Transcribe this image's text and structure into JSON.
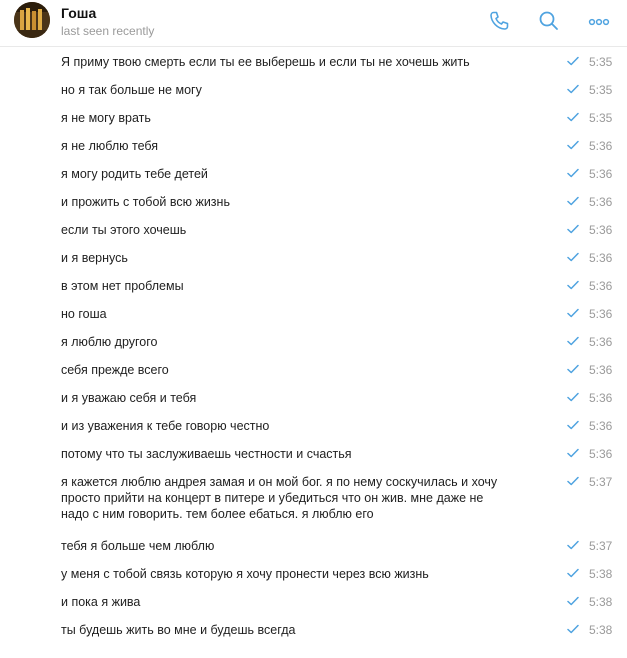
{
  "header": {
    "title": "Гоша",
    "status": "last seen recently",
    "icons": [
      "phone-icon",
      "search-icon",
      "more-icon"
    ],
    "accent_color": "#4fa3e0"
  },
  "messages": [
    {
      "text": "Я приму твою смерть если ты ее выберешь и если ты не хочешь жить",
      "time": "5:35",
      "status": "read"
    },
    {
      "text": "но я так больше не могу",
      "time": "5:35",
      "status": "read"
    },
    {
      "text": "я не могу врать",
      "time": "5:35",
      "status": "read"
    },
    {
      "text": "я не люблю тебя",
      "time": "5:36",
      "status": "read"
    },
    {
      "text": "я могу родить тебе детей",
      "time": "5:36",
      "status": "read"
    },
    {
      "text": "и прожить с тобой всю жизнь",
      "time": "5:36",
      "status": "read"
    },
    {
      "text": "если ты этого хочешь",
      "time": "5:36",
      "status": "read"
    },
    {
      "text": "и я вернусь",
      "time": "5:36",
      "status": "read"
    },
    {
      "text": "в этом нет проблемы",
      "time": "5:36",
      "status": "read"
    },
    {
      "text": "но гоша",
      "time": "5:36",
      "status": "read"
    },
    {
      "text": "я люблю другого",
      "time": "5:36",
      "status": "read"
    },
    {
      "text": "себя прежде всего",
      "time": "5:36",
      "status": "read"
    },
    {
      "text": "и я уважаю себя и тебя",
      "time": "5:36",
      "status": "read"
    },
    {
      "text": "и из уважения к тебе говорю честно",
      "time": "5:36",
      "status": "read"
    },
    {
      "text": "потому что ты заслуживаешь честности и счастья",
      "time": "5:36",
      "status": "read"
    },
    {
      "text": "я кажется люблю андрея замая и он мой бог. я по нему соскучилась и хочу просто прийти на концерт в питере и убедиться что он жив. мне даже не надо с ним говорить. тем более ебаться. я люблю его",
      "time": "5:37",
      "status": "read"
    },
    {
      "text": "тебя я больше чем люблю",
      "time": "5:37",
      "status": "read"
    },
    {
      "text": "у меня с тобой связь которую я хочу пронести через всю жизнь",
      "time": "5:38",
      "status": "read"
    },
    {
      "text": "и пока я жива",
      "time": "5:38",
      "status": "read"
    },
    {
      "text": "ты будешь жить во мне и будешь всегда",
      "time": "5:38",
      "status": "read"
    }
  ]
}
